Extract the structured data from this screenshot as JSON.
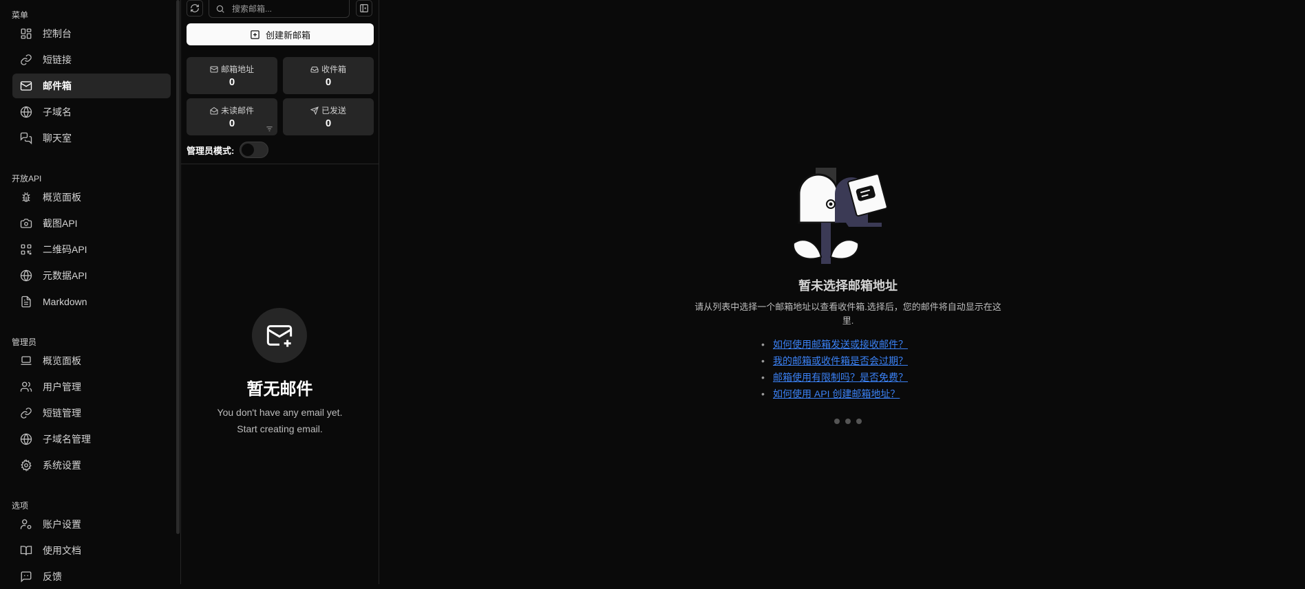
{
  "sidebar": {
    "menu_title": "菜单",
    "menu_items": [
      {
        "label": "控制台",
        "icon": "layout-dashboard-icon"
      },
      {
        "label": "短链接",
        "icon": "link-icon"
      },
      {
        "label": "邮件箱",
        "icon": "mail-icon",
        "active": true
      },
      {
        "label": "子域名",
        "icon": "globe-icon"
      },
      {
        "label": "聊天室",
        "icon": "messages-icon"
      }
    ],
    "api_title": "开放API",
    "api_items": [
      {
        "label": "概览面板",
        "icon": "bug-icon"
      },
      {
        "label": "截图API",
        "icon": "camera-icon"
      },
      {
        "label": "二维码API",
        "icon": "qr-code-icon"
      },
      {
        "label": "元数据API",
        "icon": "globe-icon"
      },
      {
        "label": "Markdown",
        "icon": "file-text-icon"
      }
    ],
    "admin_title": "管理员",
    "admin_items": [
      {
        "label": "概览面板",
        "icon": "laptop-icon"
      },
      {
        "label": "用户管理",
        "icon": "users-icon"
      },
      {
        "label": "短链管理",
        "icon": "link-icon"
      },
      {
        "label": "子域名管理",
        "icon": "globe-icon"
      },
      {
        "label": "系统设置",
        "icon": "settings-icon"
      }
    ],
    "options_title": "选项",
    "options_items": [
      {
        "label": "账户设置",
        "icon": "user-cog-icon"
      },
      {
        "label": "使用文档",
        "icon": "book-open-icon"
      },
      {
        "label": "反馈",
        "icon": "message-square-icon"
      }
    ]
  },
  "mailbox": {
    "search_placeholder": "搜索邮箱...",
    "create_label": "创建新邮箱",
    "stats": [
      {
        "label": "邮箱地址",
        "value": "0",
        "icon": "mail-icon"
      },
      {
        "label": "收件箱",
        "value": "0",
        "icon": "inbox-icon"
      },
      {
        "label": "未读邮件",
        "value": "0",
        "icon": "mail-open-icon"
      },
      {
        "label": "已发送",
        "value": "0",
        "icon": "send-icon"
      }
    ],
    "admin_mode_label": "管理员模式:",
    "admin_mode_on": false,
    "empty_title": "暂无邮件",
    "empty_line1": "You don't have any email yet.",
    "empty_line2": "Start creating email."
  },
  "main": {
    "title": "暂未选择邮箱地址",
    "description": "请从列表中选择一个邮箱地址以查看收件箱.选择后，您的邮件将自动显示在这里.",
    "faq": [
      "如何使用邮箱发送或接收邮件？",
      "我的邮箱或收件箱是否会过期？",
      "邮箱使用有限制吗？是否免费？",
      "如何使用 API 创建邮箱地址？"
    ]
  },
  "colors": {
    "background": "#0a0a0a",
    "panel": "#262626",
    "link": "#3b82f6",
    "illustration_accent": "#3b3a55"
  }
}
